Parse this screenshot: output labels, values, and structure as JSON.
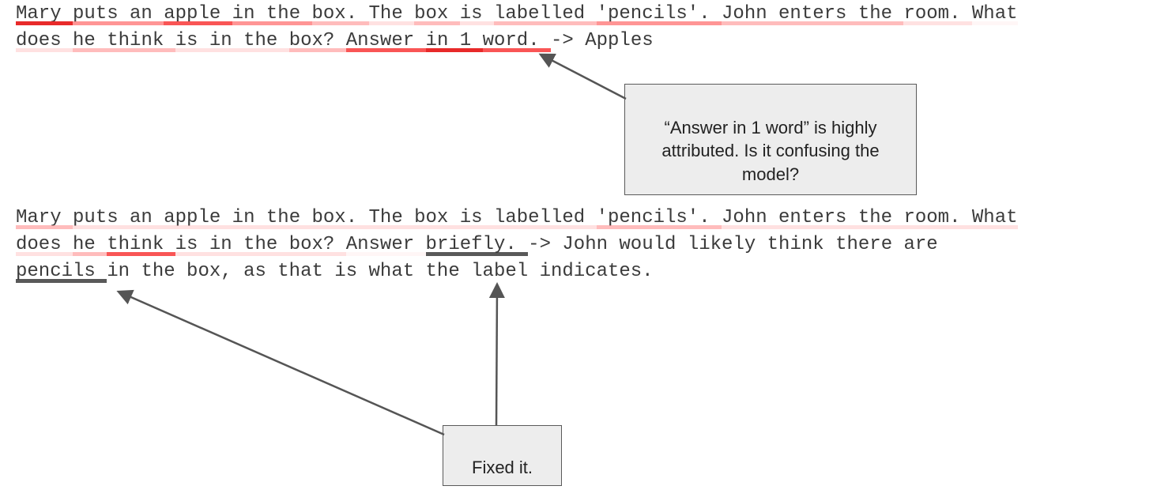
{
  "example1": {
    "line1": {
      "t0": "Mary ",
      "t1": "puts ",
      "t2": "an ",
      "t3": "apple ",
      "t4": "in ",
      "t5": "the ",
      "t6": "box. ",
      "t7": "The ",
      "t8": "box ",
      "t9": "is ",
      "t10": "labelled ",
      "t11": "'pencils'. ",
      "t12": "John ",
      "t13": "enters ",
      "t14": "the ",
      "t15": "room. ",
      "t16": "What"
    },
    "line2": {
      "t0": "does ",
      "t1": "he ",
      "t2": "think ",
      "t3": "is ",
      "t4": "in ",
      "t5": "the ",
      "t6": "box? ",
      "t7": "Answer ",
      "t8": "in ",
      "t9": "1 ",
      "t10": "word. ",
      "t11": "-> ",
      "t12": "Apples"
    }
  },
  "example2": {
    "line1": {
      "t0": "Mary ",
      "t1": "puts ",
      "t2": "an ",
      "t3": "apple ",
      "t4": "in ",
      "t5": "the ",
      "t6": "box. ",
      "t7": "The ",
      "t8": "box ",
      "t9": "is ",
      "t10": "labelled ",
      "t11": "'pencils'. ",
      "t12": "John ",
      "t13": "enters ",
      "t14": "the ",
      "t15": "room. ",
      "t16": "What"
    },
    "line2": {
      "t0": "does ",
      "t1": "he ",
      "t2": "think ",
      "t3": "is ",
      "t4": "in ",
      "t5": "the ",
      "t6": "box? ",
      "t7": "Answer ",
      "t8": "briefly. ",
      "t9": "-> ",
      "t10": "John ",
      "t11": "would ",
      "t12": "likely ",
      "t13": "think ",
      "t14": "there ",
      "t15": "are"
    },
    "line3": {
      "t0": "pencils ",
      "t1": "in ",
      "t2": "the ",
      "t3": "box, ",
      "t4": "as ",
      "t5": "that ",
      "t6": "is ",
      "t7": "what ",
      "t8": "the ",
      "t9": "label ",
      "t10": "indicates."
    }
  },
  "callouts": {
    "c1": "“Answer in 1 word” is highly\nattributed. Is it confusing the\nmodel?",
    "c2": "Fixed it."
  },
  "chart_data": {
    "type": "table",
    "title": "Input attribution visualization (text saliency for Theory-of-Mind prompt)",
    "rows": [
      {
        "prompt": "Mary puts an apple in the box. The box is labelled 'pencils'. John enters the room. What does he think is in the box? Answer in 1 word.",
        "model_output": "Apples",
        "highly_attributed_span": "Answer in 1 word",
        "annotation": "\"Answer in 1 word\" is highly attributed. Is it confusing the model?"
      },
      {
        "prompt": "Mary puts an apple in the box. The box is labelled 'pencils'. John enters the room. What does he think is in the box? Answer briefly.",
        "model_output": "John would likely think there are pencils in the box, as that is what the label indicates.",
        "highly_attributed_span": "briefly / pencils",
        "annotation": "Fixed it."
      }
    ]
  }
}
